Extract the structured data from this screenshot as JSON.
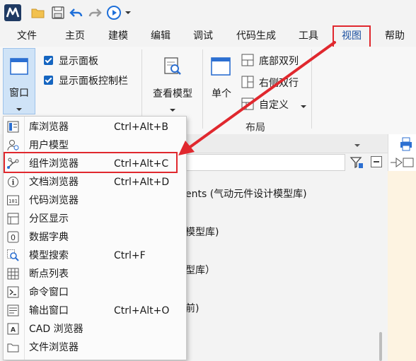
{
  "menubar": {
    "tabs": [
      {
        "label": "文件"
      },
      {
        "label": "主页"
      },
      {
        "label": "建模"
      },
      {
        "label": "编辑"
      },
      {
        "label": "调试"
      },
      {
        "label": "代码生成"
      },
      {
        "label": "工具"
      },
      {
        "label": "视图"
      },
      {
        "label": "帮助"
      }
    ],
    "active_tab": "视图"
  },
  "ribbon": {
    "window_button": "窗口",
    "show_panel": "显示面板",
    "show_panel_control_bar": "显示面板控制栏",
    "view_model": "查看模型",
    "single": "单个",
    "bottom_two_columns": "底部双列",
    "right_two_rows": "右侧双行",
    "custom": "自定义",
    "layout_group": "布局"
  },
  "dropdown": {
    "items": [
      {
        "label": "库浏览器",
        "shortcut": "Ctrl+Alt+B",
        "icon": "library-browser-icon"
      },
      {
        "label": "用户模型",
        "shortcut": "",
        "icon": "user-model-icon"
      },
      {
        "label": "组件浏览器",
        "shortcut": "Ctrl+Alt+C",
        "icon": "component-browser-icon"
      },
      {
        "label": "文档浏览器",
        "shortcut": "Ctrl+Alt+D",
        "icon": "document-browser-icon"
      },
      {
        "label": "代码浏览器",
        "shortcut": "",
        "icon": "code-browser-icon"
      },
      {
        "label": "分区显示",
        "shortcut": "",
        "icon": "partition-display-icon"
      },
      {
        "label": "数据字典",
        "shortcut": "",
        "icon": "data-dictionary-icon"
      },
      {
        "label": "模型搜索",
        "shortcut": "Ctrl+F",
        "icon": "model-search-icon"
      },
      {
        "label": "断点列表",
        "shortcut": "",
        "icon": "breakpoint-list-icon"
      },
      {
        "label": "命令窗口",
        "shortcut": "",
        "icon": "command-window-icon"
      },
      {
        "label": "输出窗口",
        "shortcut": "Ctrl+Alt+O",
        "icon": "output-window-icon"
      },
      {
        "label": "CAD 浏览器",
        "shortcut": "",
        "icon": "cad-browser-icon"
      },
      {
        "label": "文件浏览器",
        "shortcut": "",
        "icon": "file-browser-icon"
      }
    ],
    "highlighted": "组件浏览器"
  },
  "content": {
    "line1": "ents (气动元件设计模型库)",
    "line2": "模型库)",
    "line3": "型库）",
    "line4": "前)"
  },
  "colors": {
    "accent": "#1565c0",
    "highlight_red": "#e0282e",
    "text": "#1a1a1a"
  }
}
